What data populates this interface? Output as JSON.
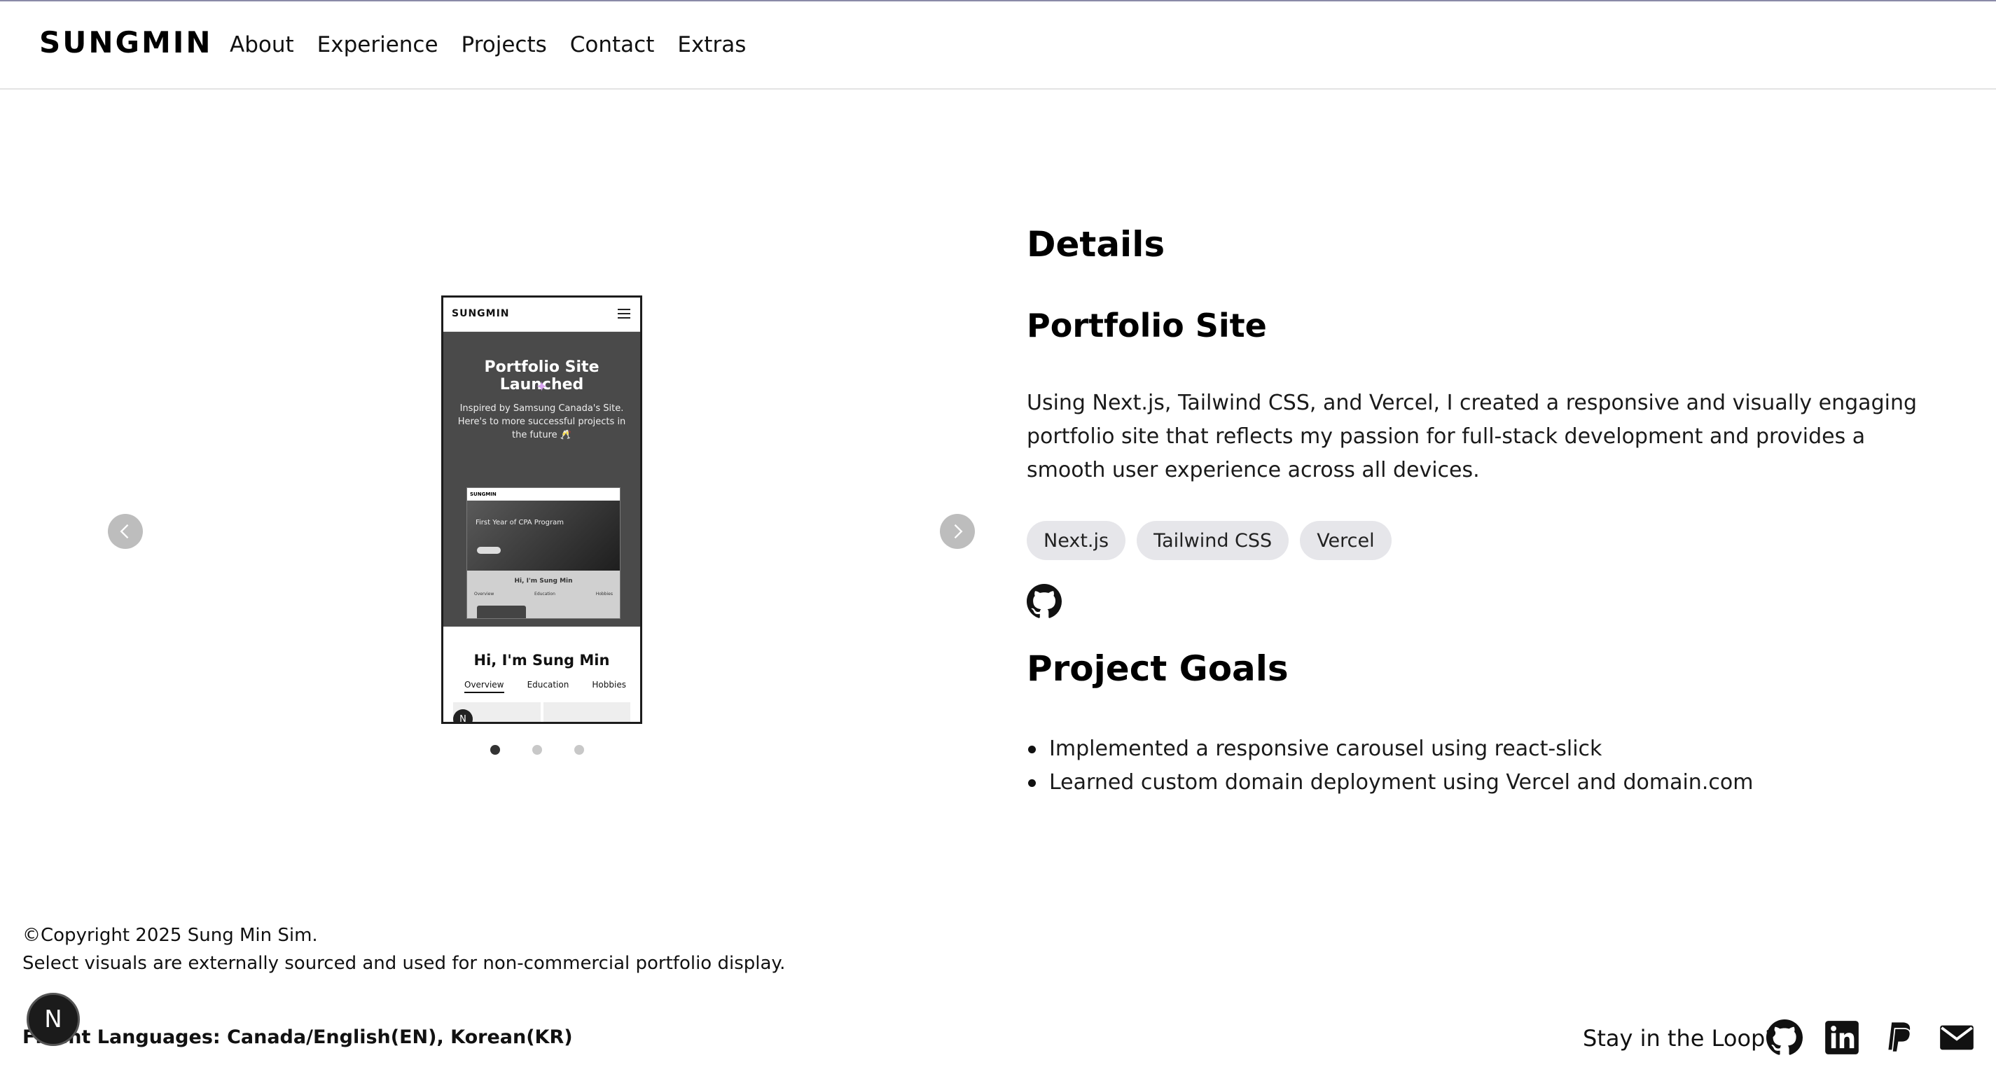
{
  "header": {
    "logo": "SUNGMIN",
    "nav": [
      "About",
      "Experience",
      "Projects",
      "Contact",
      "Extras"
    ]
  },
  "carousel": {
    "slide_count": 3,
    "active_slide": 1,
    "phone_preview": {
      "logo": "SUNGMIN",
      "hero_title": "Portfolio Site Launched",
      "hero_subtitle": "Inspired by Samsung Canada's Site. Here's to more successful projects in the future 🥂",
      "inner_banner": "First Year of CPA Program",
      "intro": "Hi, I'm Sung Min",
      "tabs": [
        "Overview",
        "Education",
        "Hobbies"
      ],
      "badge": "N"
    }
  },
  "details": {
    "heading": "Details",
    "project_title": "Portfolio Site",
    "description": "Using Next.js, Tailwind CSS, and Vercel, I created a responsive and visually engaging portfolio site that reflects my passion for full-stack development and provides a smooth user experience across all devices.",
    "tags": [
      "Next.js",
      "Tailwind CSS",
      "Vercel"
    ],
    "github_icon": "github-icon",
    "goals_heading": "Project Goals",
    "goals": [
      "Implemented a responsive carousel using react-slick",
      "Learned custom domain deployment using Vercel and domain.com"
    ]
  },
  "footer": {
    "copyright": "©Copyright 2025 Sung Min Sim.",
    "disclaimer": "Select visuals are externally sourced and used for non-commercial portfolio display.",
    "languages": "Fluent Languages: Canada/English(EN), Korean(KR)",
    "badge": "N",
    "stay_label": "Stay in the Loop?",
    "social_icons": [
      "github-icon",
      "linkedin-icon",
      "paypal-icon",
      "mail-icon"
    ]
  },
  "colors": {
    "tag_background": "#e6e6ea",
    "arrow": "#bdbdbd",
    "dot_active": "#333333",
    "dot_inactive": "#c8c8c8"
  }
}
